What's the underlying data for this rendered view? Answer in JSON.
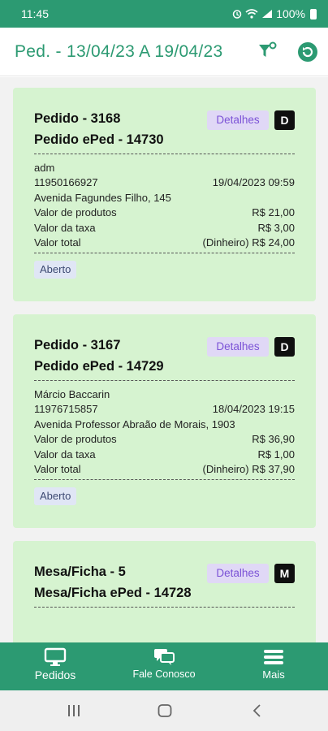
{
  "status_bar": {
    "time": "11:45",
    "battery": "100%"
  },
  "header": {
    "title": "Ped. - 13/04/23 A 19/04/23"
  },
  "orders": [
    {
      "title": "Pedido - 3168",
      "subtitle": "Pedido ePed - 14730",
      "details_label": "Detalhes",
      "type_badge": "D",
      "customer": "adm",
      "phone": "11950166927",
      "datetime": "19/04/2023 09:59",
      "address": "Avenida Fagundes Filho, 145",
      "products_label": "Valor de produtos",
      "products_value": "R$ 21,00",
      "fee_label": "Valor da taxa",
      "fee_value": "R$ 3,00",
      "total_label": "Valor total",
      "total_value": "(Dinheiro) R$ 24,00",
      "status": "Aberto"
    },
    {
      "title": "Pedido - 3167",
      "subtitle": "Pedido ePed - 14729",
      "details_label": "Detalhes",
      "type_badge": "D",
      "customer": "Márcio Baccarin",
      "phone": "11976715857",
      "datetime": "18/04/2023 19:15",
      "address": "Avenida Professor Abraão de Morais, 1903",
      "products_label": "Valor de produtos",
      "products_value": "R$ 36,90",
      "fee_label": "Valor da taxa",
      "fee_value": "R$ 1,00",
      "total_label": "Valor total",
      "total_value": "(Dinheiro) R$ 37,90",
      "status": "Aberto"
    },
    {
      "title": "Mesa/Ficha - 5",
      "subtitle": "Mesa/Ficha ePed - 14728",
      "details_label": "Detalhes",
      "type_badge": "M"
    }
  ],
  "bottom_nav": {
    "items": [
      {
        "label": "Pedidos",
        "icon": "monitor-icon"
      },
      {
        "label": "Fale Conosco",
        "icon": "chat-icon"
      },
      {
        "label": "Mais",
        "icon": "menu-icon"
      }
    ]
  },
  "colors": {
    "primary": "#2c9a72",
    "card_bg": "#d6f3d0",
    "details_bg": "#e0d8f6",
    "details_text": "#7b52d6"
  }
}
